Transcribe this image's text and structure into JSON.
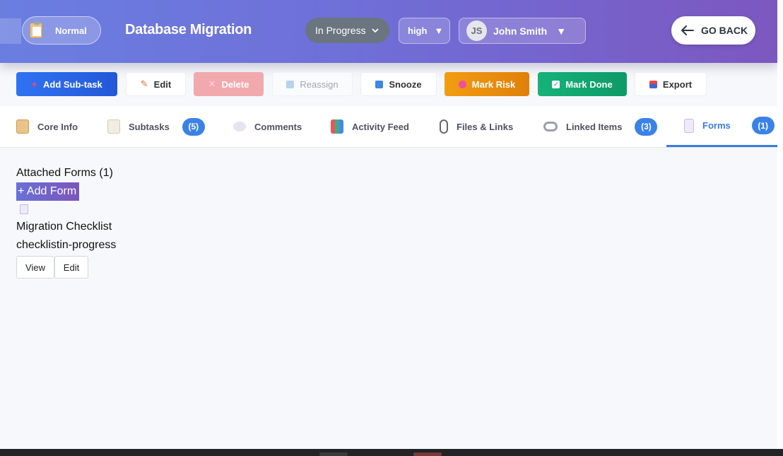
{
  "header": {
    "type_label": "Normal",
    "title": "Database Migration",
    "status": "In Progress",
    "priority": "high",
    "assignee_initials": "JS",
    "assignee_name": "John Smith",
    "go_back_label": "GO BACK",
    "colors": {
      "gradient_start": "#6a7ee0",
      "gradient_end": "#7d57c0"
    }
  },
  "toolbar": {
    "add_subtask": "Add Sub-task",
    "edit": "Edit",
    "delete": "Delete",
    "reassign": "Reassign",
    "snooze": "Snooze",
    "mark_risk": "Mark Risk",
    "mark_done": "Mark Done",
    "export": "Export"
  },
  "tabs": [
    {
      "label": "Core Info",
      "icon": "clipboard-icon"
    },
    {
      "label": "Subtasks",
      "icon": "memo-icon",
      "count": "(5)"
    },
    {
      "label": "Comments",
      "icon": "speech-bubble-icon"
    },
    {
      "label": "Activity Feed",
      "icon": "bar-chart-icon"
    },
    {
      "label": "Files & Links",
      "icon": "paperclip-icon"
    },
    {
      "label": "Linked Items",
      "icon": "link-icon",
      "count": "(3)"
    },
    {
      "label": "Forms",
      "icon": "document-icon",
      "count": "(1)",
      "active": true
    }
  ],
  "forms": {
    "heading": "Attached Forms (1)",
    "add_label": "+ Add Form",
    "items": [
      {
        "name": "Migration Checklist",
        "meta": "checklistin-progress",
        "view_label": "View",
        "edit_label": "Edit"
      }
    ]
  }
}
